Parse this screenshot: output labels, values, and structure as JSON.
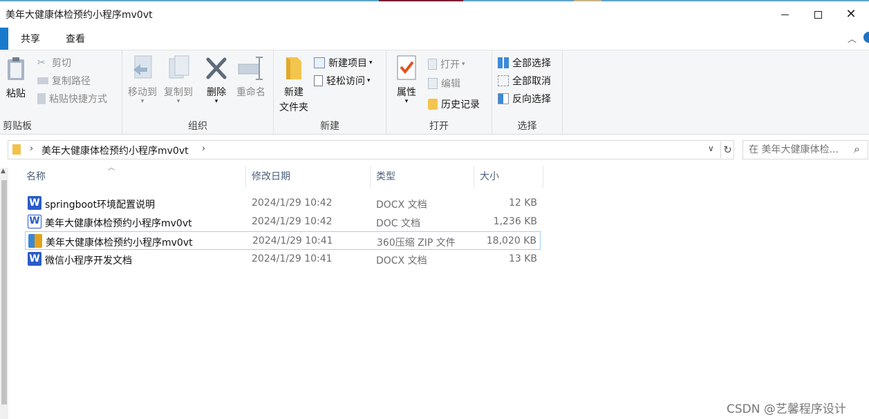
{
  "window": {
    "title": "美年大健康体检预约小程序mv0vt"
  },
  "tabs": [
    {
      "label": "共享"
    },
    {
      "label": "查看"
    }
  ],
  "ribbon": {
    "clipboard": {
      "label": "剪贴板",
      "paste": "粘贴",
      "cut": "剪切",
      "copy_path": "复制路径",
      "paste_shortcut": "粘贴快捷方式"
    },
    "organize": {
      "label": "组织",
      "move_to": "移动到",
      "copy_to": "复制到",
      "delete": "删除",
      "rename": "重命名"
    },
    "new": {
      "label": "新建",
      "new_folder_line1": "新建",
      "new_folder_line2": "文件夹",
      "new_item": "新建项目",
      "easy_access": "轻松访问"
    },
    "open": {
      "label": "打开",
      "properties": "属性",
      "open": "打开",
      "edit": "编辑",
      "history": "历史记录"
    },
    "select": {
      "label": "选择",
      "select_all": "全部选择",
      "select_none": "全部取消",
      "invert": "反向选择"
    }
  },
  "address": {
    "path": "美年大健康体检预约小程序mv0vt"
  },
  "search": {
    "placeholder": "在 美年大健康体检..."
  },
  "columns": {
    "name": "名称",
    "date": "修改日期",
    "type": "类型",
    "size": "大小"
  },
  "files": [
    {
      "name": "springboot环境配置说明",
      "date": "2024/1/29 10:42",
      "type": "DOCX 文档",
      "size": "12 KB",
      "icon": "word-docx-icon"
    },
    {
      "name": "美年大健康体检预约小程序mv0vt",
      "date": "2024/1/29 10:42",
      "type": "DOC 文档",
      "size": "1,236 KB",
      "icon": "word-doc-icon"
    },
    {
      "name": "美年大健康体检预约小程序mv0vt",
      "date": "2024/1/29 10:41",
      "type": "360压缩 ZIP 文件",
      "size": "18,020 KB",
      "icon": "zip-archive-icon"
    },
    {
      "name": "微信小程序开发文档",
      "date": "2024/1/29 10:41",
      "type": "DOCX 文档",
      "size": "13 KB",
      "icon": "word-docx-icon"
    }
  ],
  "watermark": "CSDN @艺馨程序设计"
}
